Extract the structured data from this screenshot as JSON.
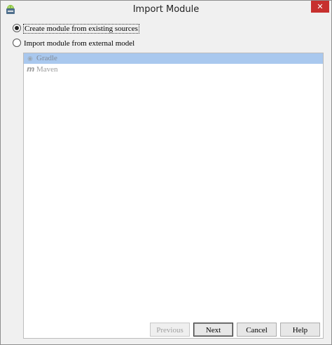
{
  "window": {
    "title": "Import Module",
    "close_label": "✕"
  },
  "options": [
    {
      "label": "Create module from existing sources",
      "checked": true
    },
    {
      "label": "Import module from external model",
      "checked": false
    }
  ],
  "models": [
    {
      "label": "Gradle",
      "icon": "gradle-icon",
      "selected": true
    },
    {
      "label": "Maven",
      "icon": "maven-icon",
      "selected": false
    }
  ],
  "buttons": {
    "previous": "Previous",
    "next": "Next",
    "cancel": "Cancel",
    "help": "Help"
  },
  "colors": {
    "title_bar": "#f0f0f0",
    "close_button": "#c7302e",
    "selection": "#a9c8ee"
  }
}
